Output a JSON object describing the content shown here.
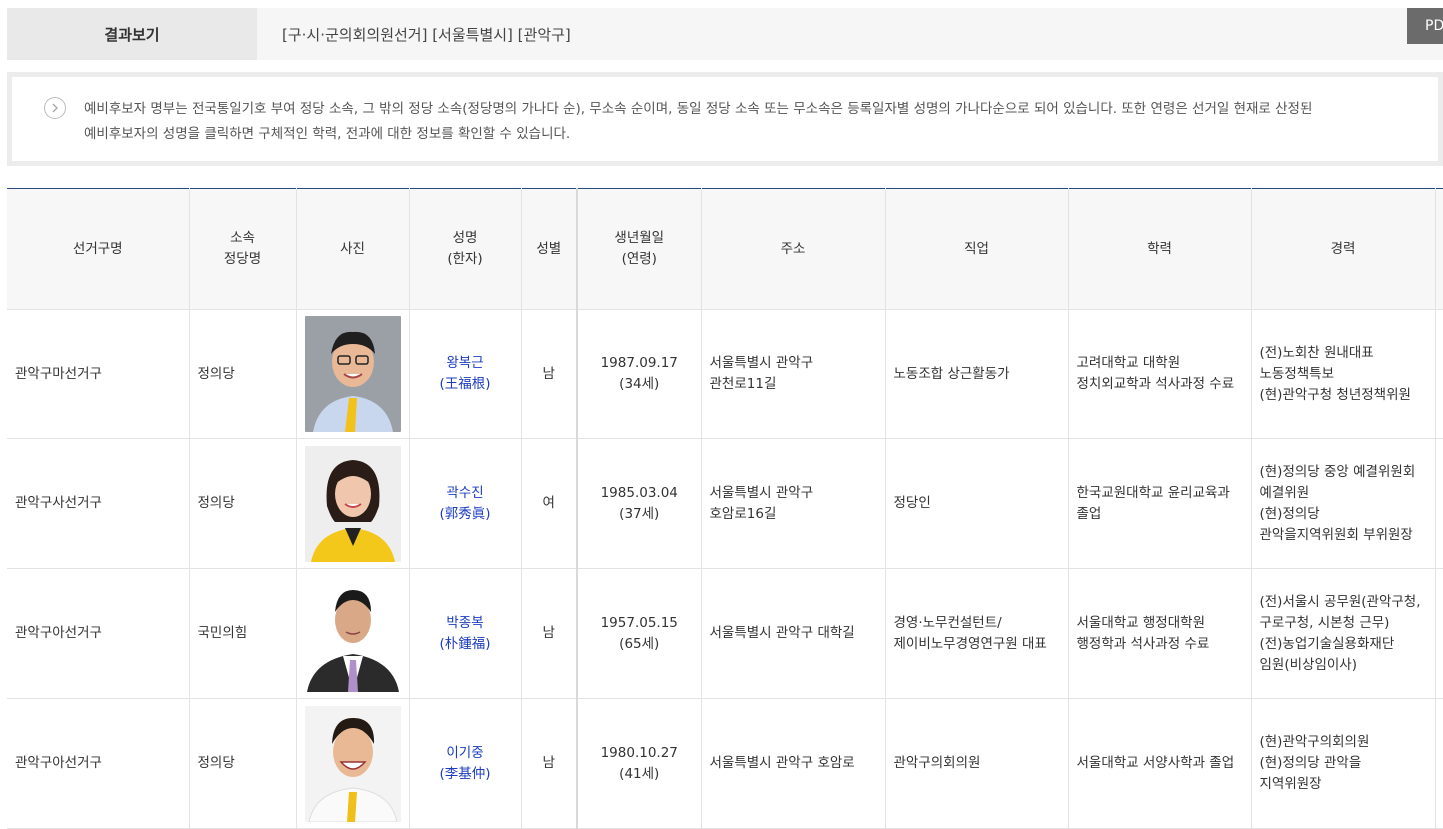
{
  "header": {
    "result_label": "결과보기",
    "result_path": "[구·시·군의회의원선거] [서울특별시] [관악구]",
    "pdf_label": "PDF"
  },
  "notice": {
    "icon": "chevron-right-icon",
    "line1": "예비후보자 명부는 전국통일기호 부여 정당 소속, 그 밖의 정당 소속(정당명의 가나다 순), 무소속 순이며, 동일 정당 소속 또는 무소속은 등록일자별 성명의 가나다순으로 되어 있습니다. 또한 연령은 선거일 현재로 산정된",
    "line2": "예비후보자의 성명을 클릭하면 구체적인 학력, 전과에 대한 정보를 확인할 수 있습니다."
  },
  "table": {
    "headers": {
      "district": "선거구명",
      "party_1": "소속",
      "party_2": "정당명",
      "photo": "사진",
      "name_1": "성명",
      "name_2": "(한자)",
      "gender": "성별",
      "birth_1": "생년월일",
      "birth_2": "(연령)",
      "address": "주소",
      "job": "직업",
      "education": "학력",
      "career": "경력"
    },
    "rows": [
      {
        "district": "관악구마선거구",
        "party": "정의당",
        "name": "왕복근",
        "hanja": "(王福根)",
        "gender": "남",
        "birth": "1987.09.17",
        "age": "(34세)",
        "address_1": "서울특별시 관악구",
        "address_2": "관천로11길",
        "job_1": "노동조합 상근활동가",
        "job_2": "",
        "edu_1": "고려대학교 대학원",
        "edu_2": "정치외교학과 석사과정 수료",
        "career_1": "(전)노회찬 원내대표",
        "career_2": "노동정책특보",
        "career_3": "(현)관악구청 청년정책위원",
        "career_4": ""
      },
      {
        "district": "관악구사선거구",
        "party": "정의당",
        "name": "곽수진",
        "hanja": "(郭秀眞)",
        "gender": "여",
        "birth": "1985.03.04",
        "age": "(37세)",
        "address_1": "서울특별시 관악구",
        "address_2": "호암로16길",
        "job_1": "정당인",
        "job_2": "",
        "edu_1": "한국교원대학교 윤리교육과",
        "edu_2": "졸업",
        "career_1": "(현)정의당 중앙 예결위원회",
        "career_2": "예결위원",
        "career_3": "(현)정의당",
        "career_4": "관악을지역위원회 부위원장"
      },
      {
        "district": "관악구아선거구",
        "party": "국민의힘",
        "name": "박종복",
        "hanja": "(朴鍾福)",
        "gender": "남",
        "birth": "1957.05.15",
        "age": "(65세)",
        "address_1": "서울특별시 관악구 대학길",
        "address_2": "",
        "job_1": "경영·노무컨설턴트/",
        "job_2": "제이비노무경영연구원 대표",
        "edu_1": "서울대학교 행정대학원",
        "edu_2": "행정학과 석사과정 수료",
        "career_1": "(전)서울시 공무원(관악구청,",
        "career_2": "구로구청, 시본청 근무)",
        "career_3": "(전)농업기술실용화재단",
        "career_4": "임원(비상임이사)"
      },
      {
        "district": "관악구아선거구",
        "party": "정의당",
        "name": "이기중",
        "hanja": "(李基仲)",
        "gender": "남",
        "birth": "1980.10.27",
        "age": "(41세)",
        "address_1": "서울특별시 관악구 호암로",
        "address_2": "",
        "job_1": "관악구의회의원",
        "job_2": "",
        "edu_1": "서울대학교 서양사학과 졸업",
        "edu_2": "",
        "career_1": "(현)관악구의회의원",
        "career_2": "(현)정의당 관악을",
        "career_3": "지역위원장",
        "career_4": ""
      }
    ]
  }
}
